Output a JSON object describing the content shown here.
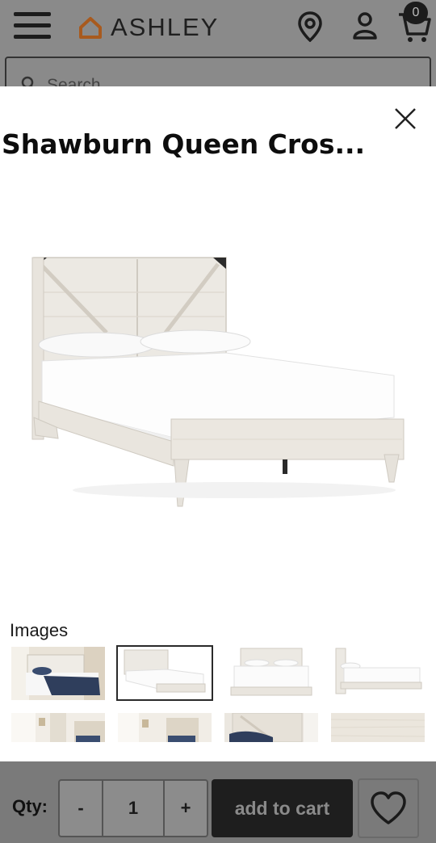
{
  "header": {
    "logo_text": "ASHLEY",
    "cart_count": "0",
    "search_placeholder": "Search"
  },
  "modal": {
    "title": "Shawburn Queen Cros...",
    "images_label": "Images",
    "thumbnails": [
      {
        "name": "thumb-1-bedroom"
      },
      {
        "name": "thumb-2-selected"
      },
      {
        "name": "thumb-3-front"
      },
      {
        "name": "thumb-4-side"
      },
      {
        "name": "thumb-5-room"
      },
      {
        "name": "thumb-6-room"
      },
      {
        "name": "thumb-7-headboard"
      },
      {
        "name": "thumb-8-wood"
      }
    ]
  },
  "cart_bar": {
    "qty_label": "Qty:",
    "minus_label": "-",
    "quantity": "1",
    "plus_label": "+",
    "add_to_cart_label": "add to cart"
  },
  "colors": {
    "overlay": "#7a7a7a",
    "button_dark": "#1e1e1e",
    "logo_accent": "#b5651d"
  }
}
